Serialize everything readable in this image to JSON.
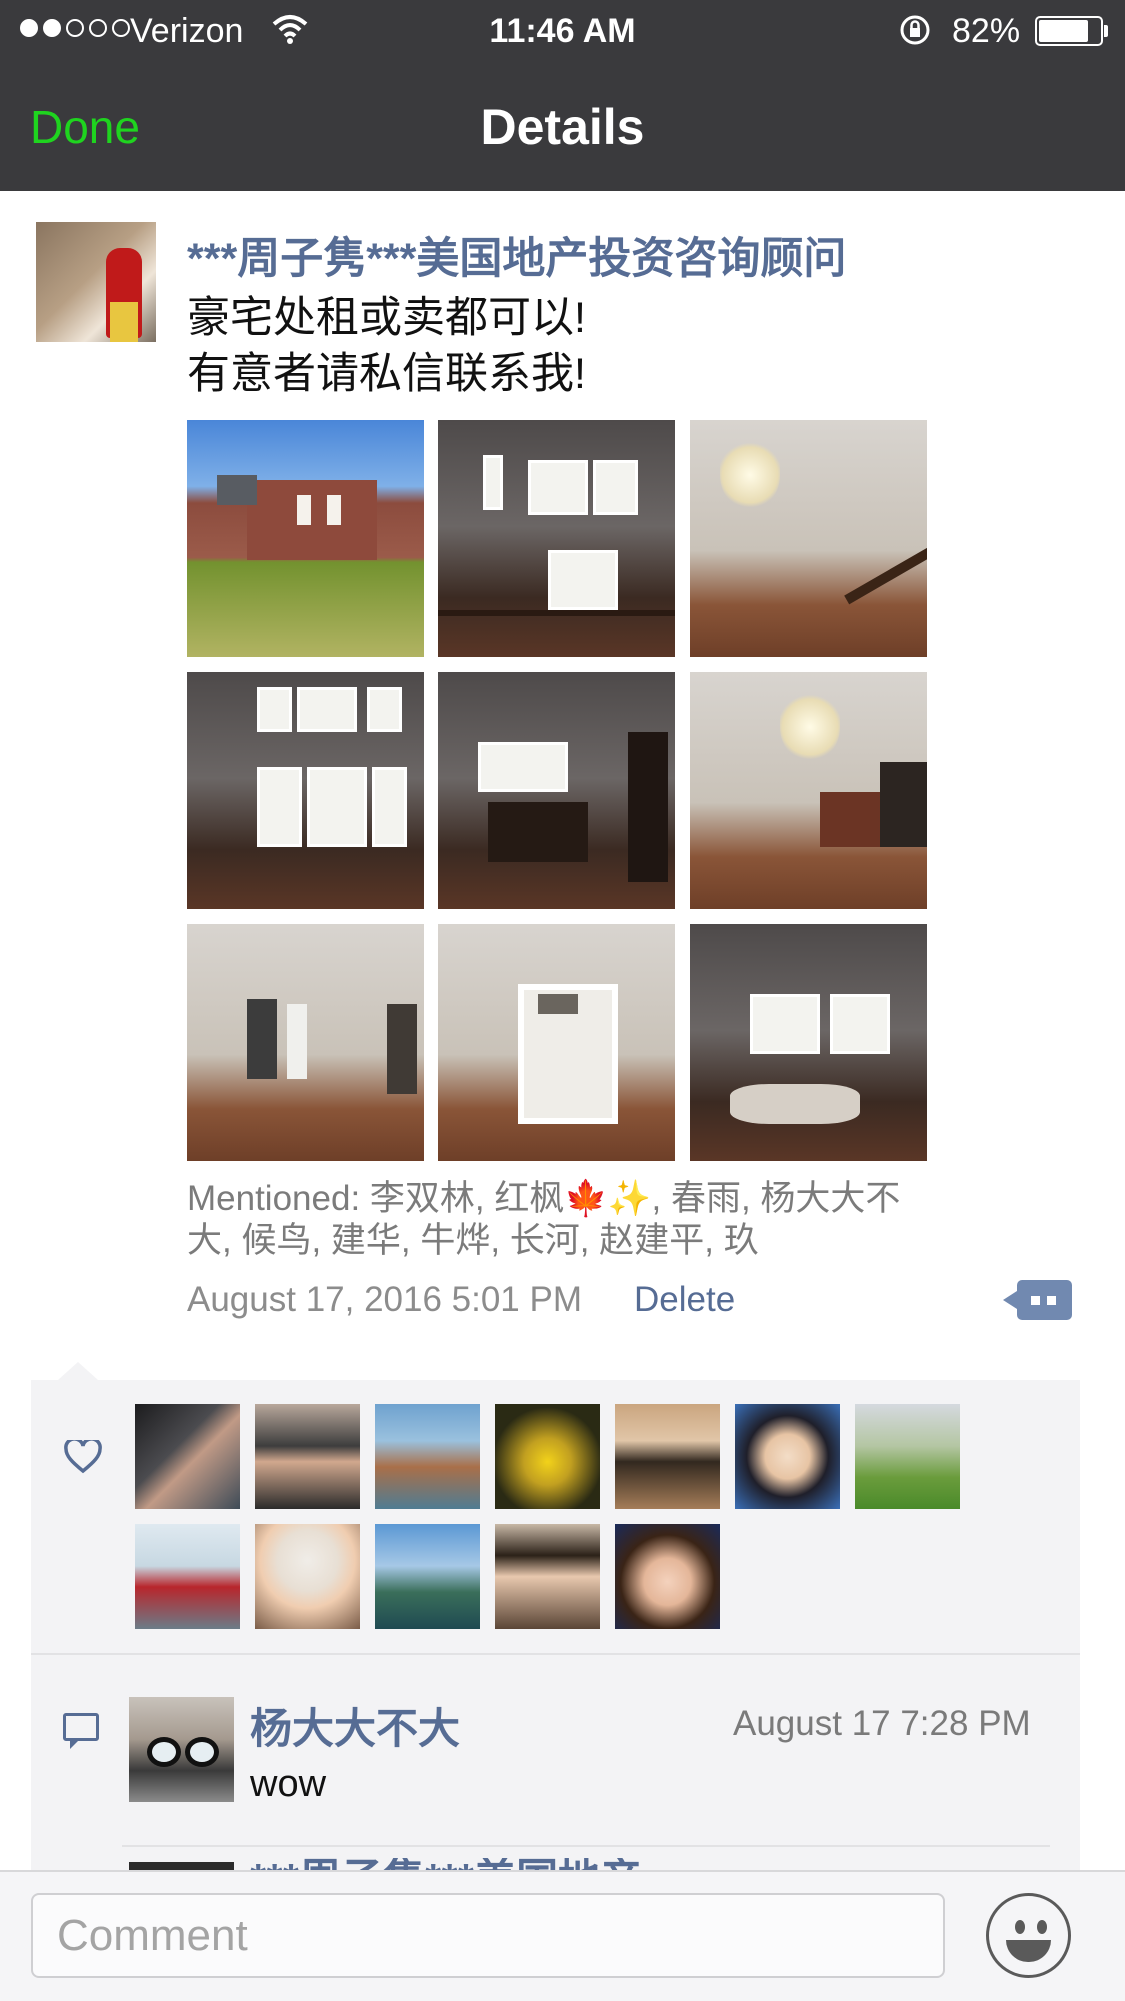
{
  "status_bar": {
    "carrier": "Verizon",
    "time": "11:46 AM",
    "battery_percent": "82%",
    "battery_level": 0.82,
    "signal_bars": 2,
    "signal_max": 5
  },
  "nav": {
    "done_label": "Done",
    "title": "Details",
    "done_color": "#1fd41f"
  },
  "post": {
    "author": "***周子隽***美国地产投资咨询顾问",
    "text_line1": "豪宅处租或卖都可以!",
    "text_line2": "有意者请私信联系我!",
    "photos": [
      "house-exterior-photo",
      "foyer-windows-photo",
      "chandelier-stairs-photo",
      "living-room-windows-photo",
      "kitchen-island-photo",
      "dining-chandelier-photo",
      "empty-room-photo",
      "hallway-photo",
      "master-bath-photo"
    ],
    "mentioned": "Mentioned: 李双林, 红枫🍁✨, 春雨, 杨大大不大, 候鸟, 建华, 牛烨, 长河, 赵建平, 玖",
    "timestamp": "August 17, 2016 5:01 PM",
    "delete_label": "Delete"
  },
  "likes": {
    "icon": "heart-icon",
    "likers": [
      "liker-avatar-1",
      "liker-avatar-2",
      "liker-avatar-3",
      "liker-avatar-4",
      "liker-avatar-5",
      "liker-avatar-6",
      "liker-avatar-7",
      "liker-avatar-8",
      "liker-avatar-9",
      "liker-avatar-10",
      "liker-avatar-11",
      "liker-avatar-12"
    ]
  },
  "comments": [
    {
      "name": "杨大大不大",
      "time": "August 17 7:28 PM",
      "text": "wow"
    },
    {
      "name": "***周子隽***美国地产",
      "time": "",
      "text": ""
    }
  ],
  "comment_bar": {
    "placeholder": "Comment",
    "emoji_icon": "smiley-icon"
  },
  "colors": {
    "link": "#566c94",
    "navbar": "#3a3a3d",
    "panel": "#f3f3f5"
  }
}
